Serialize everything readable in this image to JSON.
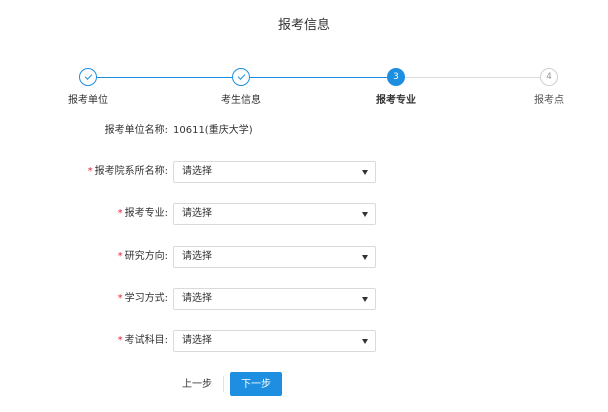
{
  "page": {
    "title": "报考信息"
  },
  "steps": [
    {
      "label": "报考单位",
      "state": "done",
      "number": ""
    },
    {
      "label": "考生信息",
      "state": "done",
      "number": ""
    },
    {
      "label": "报考专业",
      "state": "active",
      "number": "3"
    },
    {
      "label": "报考点",
      "state": "todo",
      "number": "4"
    }
  ],
  "form": {
    "unit": {
      "label": "报考单位名称:",
      "value": "10611(重庆大学)"
    },
    "department": {
      "label": "报考院系所名称:",
      "placeholder": "请选择",
      "required": "*"
    },
    "major": {
      "label": "报考专业:",
      "placeholder": "请选择",
      "required": "*"
    },
    "direction": {
      "label": "研究方向:",
      "placeholder": "请选择",
      "required": "*"
    },
    "study_mode": {
      "label": "学习方式:",
      "placeholder": "请选择",
      "required": "*"
    },
    "exam_subject": {
      "label": "考试科目:",
      "placeholder": "请选择",
      "required": "*"
    }
  },
  "buttons": {
    "prev": "上一步",
    "next": "下一步"
  },
  "colors": {
    "accent": "#1e8fe0",
    "required": "#e0283c"
  }
}
